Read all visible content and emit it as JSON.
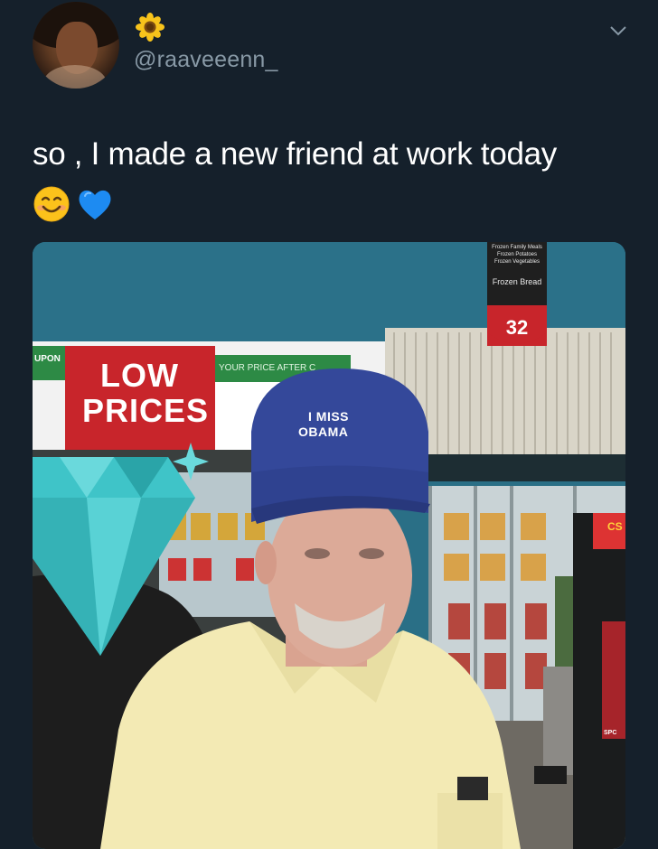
{
  "tweet": {
    "handle": "@raaveeenn_",
    "text": "so , I made a new friend at work today",
    "emojis": [
      "smiling-face-emoji",
      "blue-heart-emoji"
    ],
    "icons": {
      "flower": "sunflower-icon",
      "menu": "chevron-down-icon"
    }
  },
  "photo": {
    "sign_low_prices_line1": "LOW",
    "sign_low_prices_line2": "PRICES",
    "sign_coupon": "UPON",
    "sign_your_price": "YOUR PRICE AFTER C",
    "aisle_sign_lines": [
      "Frozen Family Meals",
      "Frozen Potatoes",
      "Frozen Vegetables",
      "Frozen Bread"
    ],
    "aisle_number": "32",
    "hat_line1": "I MISS",
    "hat_line2": "OBAMA",
    "machine_label": "CS",
    "machine_label2": "SPC"
  },
  "colors": {
    "background": "#15202b",
    "text": "#ffffff",
    "secondary_text": "#8899a6",
    "sign_red": "#c8252b",
    "hat_blue": "#34489a",
    "shirt_yellow": "#f3eab4",
    "diamond_teal": "#3fc4c8"
  }
}
